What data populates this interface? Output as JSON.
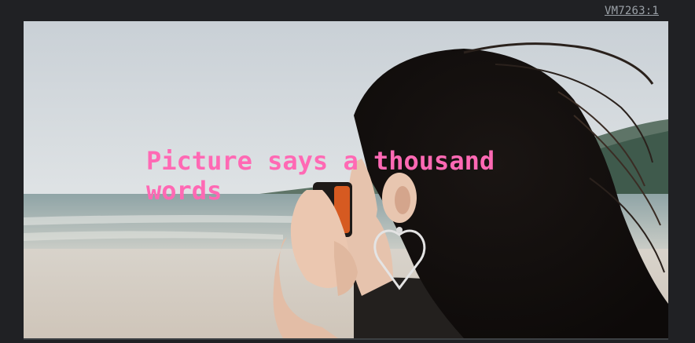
{
  "console": {
    "source_link": "VM7263:1"
  },
  "image": {
    "alt_description_icon": "photo-woman-camera-beach"
  },
  "overlay": {
    "text": "Picture says a thousand words",
    "color": "#ff69b4"
  },
  "colors": {
    "background": "#202124",
    "link": "#9aa0a6"
  }
}
